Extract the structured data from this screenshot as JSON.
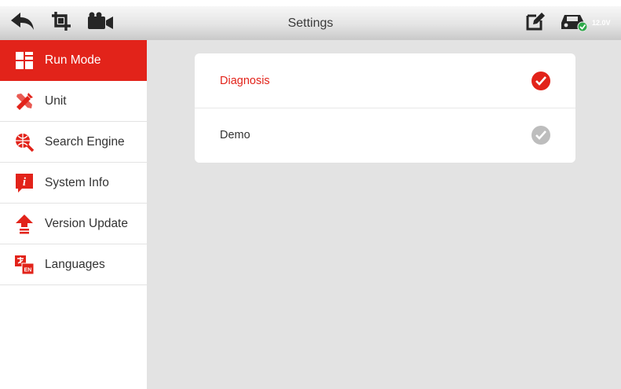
{
  "header": {
    "title": "Settings",
    "voltage": "12.0V",
    "icons": [
      "back-arrow-icon",
      "crop-icon",
      "video-camera-icon",
      "edit-icon",
      "vci-car-icon"
    ]
  },
  "sidebar": {
    "items": [
      {
        "label": "Run Mode",
        "icon": "run-mode-icon",
        "active": true
      },
      {
        "label": "Unit",
        "icon": "unit-tools-icon",
        "active": false
      },
      {
        "label": "Search Engine",
        "icon": "search-globe-icon",
        "active": false
      },
      {
        "label": "System Info",
        "icon": "info-icon",
        "active": false
      },
      {
        "label": "Version Update",
        "icon": "upload-arrow-icon",
        "active": false
      },
      {
        "label": "Languages",
        "icon": "language-icon",
        "active": false
      }
    ]
  },
  "main": {
    "options": [
      {
        "label": "Diagnosis",
        "selected": true
      },
      {
        "label": "Demo",
        "selected": false
      }
    ]
  },
  "colors": {
    "accent": "#e2231a",
    "background": "#e3e3e3",
    "unchecked": "#bdbdbd"
  }
}
